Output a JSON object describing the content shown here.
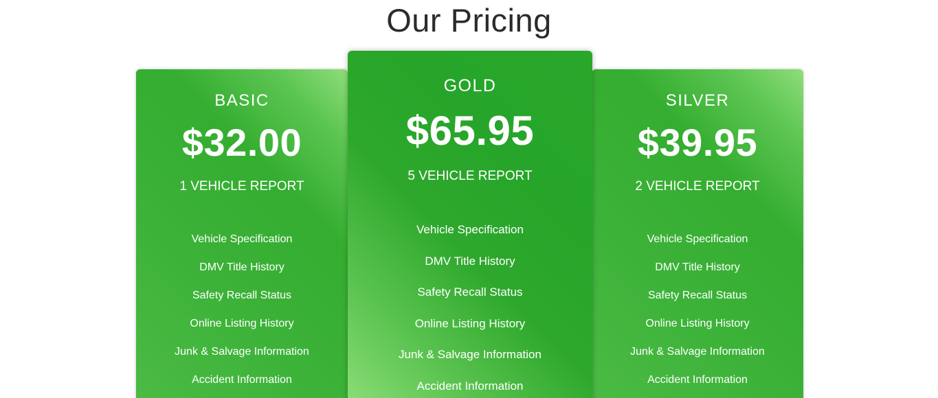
{
  "section": {
    "title": "Our Pricing"
  },
  "plans": [
    {
      "name": "BASIC",
      "price": "$32.00",
      "report": "1 VEHICLE REPORT",
      "features": [
        "Vehicle Specification",
        "DMV Title History",
        "Safety Recall Status",
        "Online Listing History",
        "Junk & Salvage Information",
        "Accident Information"
      ]
    },
    {
      "name": "GOLD",
      "price": "$65.95",
      "report": "5 VEHICLE REPORT",
      "features": [
        "Vehicle Specification",
        "DMV Title History",
        "Safety Recall Status",
        "Online Listing History",
        "Junk & Salvage Information",
        "Accident Information"
      ]
    },
    {
      "name": "SILVER",
      "price": "$39.95",
      "report": "2 VEHICLE REPORT",
      "features": [
        "Vehicle Specification",
        "DMV Title History",
        "Safety Recall Status",
        "Online Listing History",
        "Junk & Salvage Information",
        "Accident Information"
      ]
    }
  ],
  "colors": {
    "card_green": "#34ad30",
    "card_highlight": "#8fdd7a",
    "title_text": "#2b2b2b",
    "card_text": "#ffffff"
  }
}
